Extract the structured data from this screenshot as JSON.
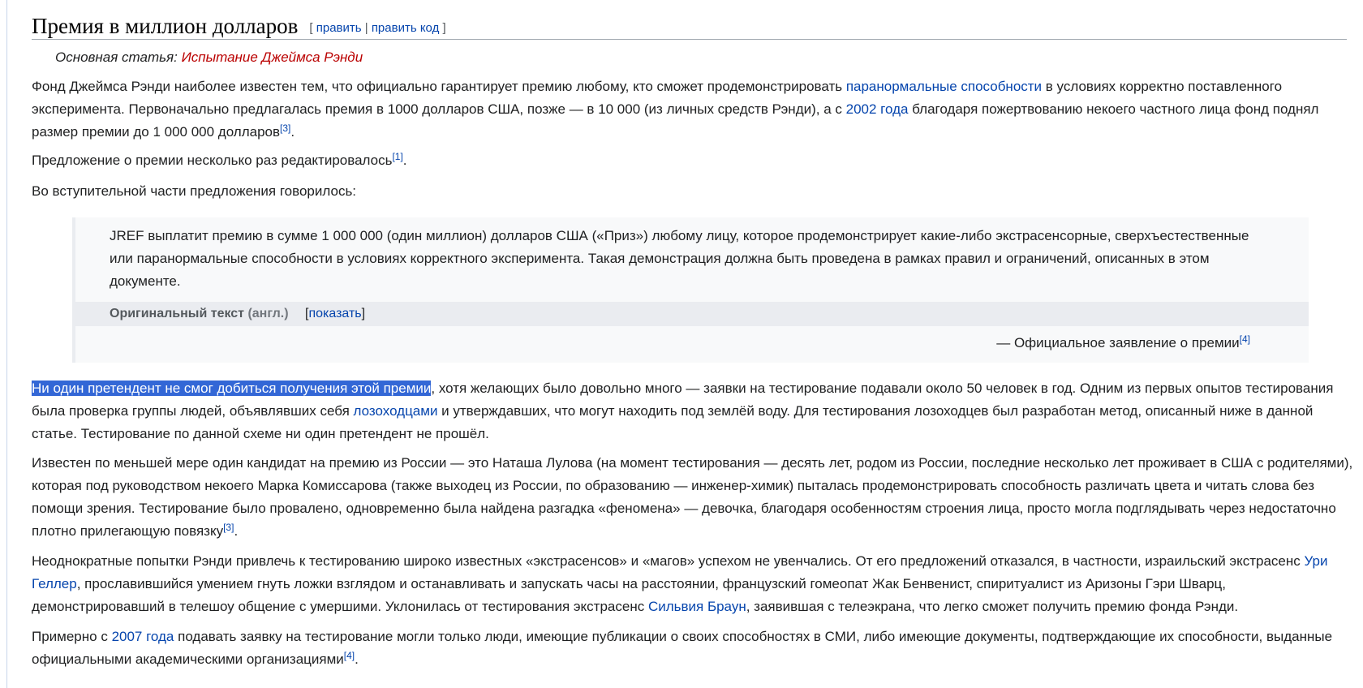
{
  "heading": {
    "title": "Премия в миллион долларов",
    "edit": "править",
    "edit_source": "править код"
  },
  "hatnote": {
    "label": "Основная статья:",
    "link": "Испытание Джеймса Рэнди"
  },
  "paragraphs": [
    {
      "segments": [
        {
          "t": "Фонд Джеймса Рэнди наиболее известен тем, что официально гарантирует премию любому, кто сможет продемонстрировать "
        },
        {
          "t": "паранормальные способности",
          "link": true
        },
        {
          "t": " в условиях корректно поставленного эксперимента. Первоначально предлагалась премия в 1000 долларов США, позже — в 10 000 (из личных средств Рэнди), а с "
        },
        {
          "t": "2002 года",
          "link": true
        },
        {
          "t": " благодаря пожертвованию некоего частного лица фонд поднял размер премии до 1 000 000 долларов"
        },
        {
          "t": "[3]",
          "sup": true
        },
        {
          "t": "."
        }
      ]
    },
    {
      "segments": [
        {
          "t": "Предложение о премии несколько раз редактировалось"
        },
        {
          "t": "[1]",
          "sup": true
        },
        {
          "t": "."
        }
      ]
    },
    {
      "segments": [
        {
          "t": "Во вступительной части предложения говорилось:"
        }
      ]
    },
    {
      "segments": [
        {
          "t": "Ни один претендент не смог добиться получения этой премии",
          "sel": true
        },
        {
          "t": ", хотя желающих было довольно много — заявки на тестирование подавали около 50 человек в год. Одним из первых опытов тестирования была проверка группы людей, объявлявших себя "
        },
        {
          "t": "лозоходцами",
          "link": true
        },
        {
          "t": " и утверждавших, что могут находить под землёй воду. Для тестирования лозоходцев был разработан метод, описанный ниже в данной статье. Тестирование по данной схеме ни один претендент не прошёл."
        }
      ]
    },
    {
      "segments": [
        {
          "t": "Известен по меньшей мере один кандидат на премию из России — это Наташа Лулова (на момент тестирования — десять лет, родом из России, последние несколько лет проживает в США с родителями), которая под руководством некоего Марка Комиссарова (также выходец из России, по образованию — инженер-химик) пыталась продемонстрировать способность различать цвета и читать слова без помощи зрения. Тестирование было провалено, одновременно была найдена разгадка «феномена» — девочка, благодаря особенностям строения лица, просто могла подглядывать через недостаточно плотно прилегающую повязку"
        },
        {
          "t": "[3]",
          "sup": true
        },
        {
          "t": "."
        }
      ]
    },
    {
      "segments": [
        {
          "t": "Неоднократные попытки Рэнди привлечь к тестированию широко известных «экстрасенсов» и «магов» успехом не увенчались. От его предложений отказался, в частности, израильский экстрасенс "
        },
        {
          "t": "Ури Геллер",
          "link": true
        },
        {
          "t": ", прославившийся умением гнуть ложки взглядом и останавливать и запускать часы на расстоянии, французский гомеопат Жак Бенвенист, спиритуалист из Аризоны Гэри Шварц, демонстрировавший в телешоу общение с умершими. Уклонилась от тестирования экстрасенс "
        },
        {
          "t": "Сильвия Браун",
          "link": true
        },
        {
          "t": ", заявившая с телеэкрана, что легко сможет получить премию фонда Рэнди."
        }
      ]
    },
    {
      "segments": [
        {
          "t": "Примерно с "
        },
        {
          "t": "2007 года",
          "link": true
        },
        {
          "t": " подавать заявку на тестирование могли только люди, имеющие публикации о своих способностях в СМИ, либо имеющие документы, подтверждающие их способности, выданные официальными академическими организациями"
        },
        {
          "t": "[4]",
          "sup": true
        },
        {
          "t": "."
        }
      ]
    }
  ],
  "quote": {
    "text": "JREF выплатит премию в сумме 1 000 000 (один миллион) долларов США («Приз») любому лицу, которое продемонстрирует какие-либо экстрасенсорные, сверхъестественные или паранормальные способности в условиях корректного эксперимента. Такая демонстрация должна быть проведена в рамках правил и ограничений, описанных в этом документе.",
    "original_label": "Оригинальный текст",
    "original_lang": "(англ.)",
    "show": "показать",
    "signature": "— Официальное заявление о премии",
    "signature_ref": "[4]"
  }
}
